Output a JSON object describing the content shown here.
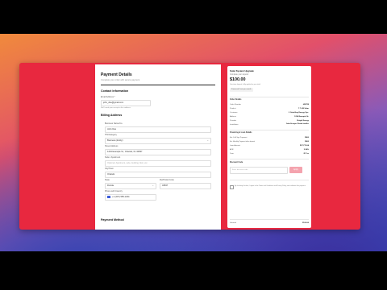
{
  "form": {
    "title": "Payment Details",
    "subtitle": "Complete your order with secure payment.",
    "contact_heading": "Contact Information",
    "email_label": "Email Address *",
    "email_value": "john_doe@gmail.com",
    "email_help": "We'll send your receipt to this address.",
    "billing_heading": "Billing Address",
    "fields": [
      {
        "label": "Business Name/Co.",
        "value": "John Doe",
        "is_placeholder": false
      },
      {
        "label": "TIN/Category",
        "value": "Business (Entity)",
        "is_placeholder": false,
        "dropdown": true
      },
      {
        "label": "Street Address",
        "value": "1234 Example St., Orlando, FL 32837",
        "is_placeholder": false
      },
      {
        "label": "Suite / Apartment",
        "value": "Optional: Apartment, suite, building, floor, etc.",
        "is_placeholder": true
      },
      {
        "label": "City/Town",
        "value": "Orlando",
        "is_placeholder": false
      }
    ],
    "state_label": "State",
    "state_value": "Florida",
    "zip_label": "Zip/Postal Code",
    "zip_value": "32837",
    "phone_label": "Phone with Country",
    "phone_value": "+1 (407) 555-1234",
    "payment_heading": "Payment Method"
  },
  "summary": {
    "title": "Solar System Upgrade",
    "subtitle": "Complete your deposit",
    "price": "$100.00",
    "price_note": "One-time deposit, fully applied to your total",
    "badge": "Financed Cost per month",
    "order_heading": "Order Details",
    "order_rows": [
      {
        "label": "Order Number",
        "value": "#38728"
      },
      {
        "label": "Product",
        "value": "7.7 kW Solar"
      },
      {
        "label": "Customer",
        "value": "J. Schelling Energy Sys."
      },
      {
        "label": "Address",
        "value": "1234 Example St."
      },
      {
        "label": "Provider",
        "value": "Bright Energy"
      },
      {
        "label": "Installation",
        "value": "Solar Energies Florida Installer"
      }
    ],
    "financing_heading": "Financing & Loan Details",
    "financing_rows": [
      {
        "label": "Est. Full Sys Payment",
        "value": "$800"
      },
      {
        "label": "Est. Monthly Payment after deposit",
        "value": "$800"
      },
      {
        "label": "Loan Amount",
        "value": "$27,770.04"
      },
      {
        "label": "APR",
        "value": "3.99%"
      },
      {
        "label": "Term",
        "value": "25 Yrs"
      }
    ],
    "discount_heading": "Discount Code",
    "discount_placeholder": "Enter discount code",
    "apply_label": "Apply",
    "terms_text": "By checking this box, I agree to the Terms and Conditions and Privacy Policy, and authorize this payment.",
    "subtotal_label": "Subtotal",
    "subtotal_value": "$100.00"
  },
  "colors": {
    "window_bg": "#e8283f",
    "apply_button": "#f4a3ae"
  }
}
